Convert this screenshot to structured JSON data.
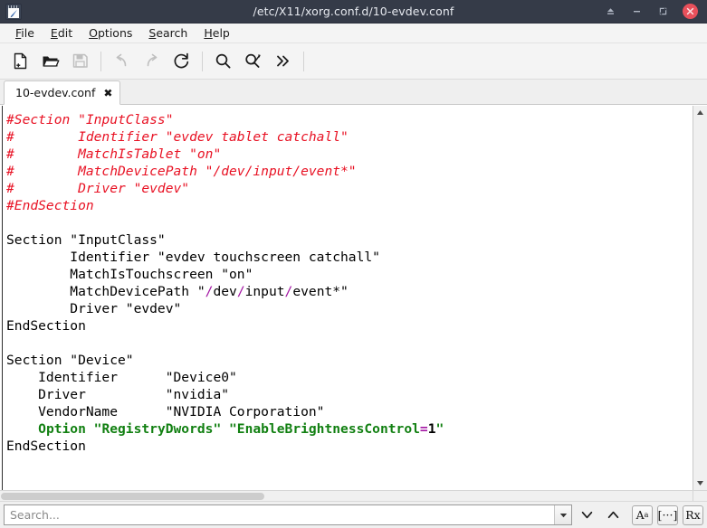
{
  "window": {
    "title": "/etc/X11/xorg.conf.d/10-evdev.conf",
    "icon": "text-editor-icon",
    "titlebar_color": "#353b48",
    "buttons": [
      {
        "name": "shade-button",
        "glyph": "eject"
      },
      {
        "name": "minimize-button",
        "glyph": "minus"
      },
      {
        "name": "restore-button",
        "glyph": "restore"
      },
      {
        "name": "close-button",
        "glyph": "cross",
        "color": "#e8505b"
      }
    ]
  },
  "menubar": {
    "items": [
      {
        "mnemonic": "F",
        "rest": "ile",
        "name": "menu-file"
      },
      {
        "mnemonic": "E",
        "rest": "dit",
        "name": "menu-edit"
      },
      {
        "mnemonic": "O",
        "rest": "ptions",
        "name": "menu-options"
      },
      {
        "mnemonic": "S",
        "rest": "earch",
        "name": "menu-search"
      },
      {
        "mnemonic": "H",
        "rest": "elp",
        "name": "menu-help"
      }
    ]
  },
  "toolbar": {
    "buttons": [
      {
        "name": "new-file-icon",
        "label": "New",
        "enabled": true
      },
      {
        "name": "open-folder-icon",
        "label": "Open",
        "enabled": true
      },
      {
        "name": "save-icon",
        "label": "Save",
        "enabled": false
      },
      {
        "name": "undo-icon",
        "label": "Undo",
        "enabled": false
      },
      {
        "name": "redo-icon",
        "label": "Redo",
        "enabled": false
      },
      {
        "name": "reload-icon",
        "label": "Reload",
        "enabled": true
      },
      {
        "name": "search-icon",
        "label": "Find",
        "enabled": true
      },
      {
        "name": "find-replace-icon",
        "label": "Find/Replace",
        "enabled": true
      },
      {
        "name": "overflow-chevrons-icon",
        "label": "More",
        "enabled": true
      }
    ]
  },
  "tabs": [
    {
      "label": "10-evdev.conf",
      "close": "✖",
      "active": true
    }
  ],
  "editor": {
    "lines": [
      [
        {
          "t": "#Section \"InputClass\"",
          "c": "cmt"
        }
      ],
      [
        {
          "t": "#        Identifier \"evdev tablet catchall\"",
          "c": "cmt"
        }
      ],
      [
        {
          "t": "#        MatchIsTablet \"on\"",
          "c": "cmt"
        }
      ],
      [
        {
          "t": "#        MatchDevicePath \"/dev/input/event*\"",
          "c": "cmt"
        }
      ],
      [
        {
          "t": "#        Driver \"evdev\"",
          "c": "cmt"
        }
      ],
      [
        {
          "t": "#EndSection",
          "c": "cmt"
        }
      ],
      [
        {
          "t": "",
          "c": ""
        }
      ],
      [
        {
          "t": "Section \"InputClass\"",
          "c": ""
        }
      ],
      [
        {
          "t": "        Identifier \"evdev touchscreen catchall\"",
          "c": ""
        }
      ],
      [
        {
          "t": "        MatchIsTouchscreen \"on\"",
          "c": ""
        }
      ],
      [
        {
          "t": "        MatchDevicePath \"",
          "c": ""
        },
        {
          "t": "/",
          "c": "slash"
        },
        {
          "t": "dev",
          "c": ""
        },
        {
          "t": "/",
          "c": "slash"
        },
        {
          "t": "input",
          "c": ""
        },
        {
          "t": "/",
          "c": "slash"
        },
        {
          "t": "event*\"",
          "c": ""
        }
      ],
      [
        {
          "t": "        Driver \"evdev\"",
          "c": ""
        }
      ],
      [
        {
          "t": "EndSection",
          "c": ""
        }
      ],
      [
        {
          "t": "",
          "c": ""
        }
      ],
      [
        {
          "t": "Section \"Device\"",
          "c": ""
        }
      ],
      [
        {
          "t": "    Identifier      \"Device0\"",
          "c": ""
        }
      ],
      [
        {
          "t": "    Driver          \"nvidia\"",
          "c": ""
        }
      ],
      [
        {
          "t": "    VendorName      \"NVIDIA Corporation\"",
          "c": ""
        }
      ],
      [
        {
          "t": "    ",
          "c": ""
        },
        {
          "t": "Option \"RegistryDwords\" \"EnableBrightnessControl",
          "c": "opt"
        },
        {
          "t": "=",
          "c": "pnc"
        },
        {
          "t": "1",
          "c": "num"
        },
        {
          "t": "\"",
          "c": "opt"
        }
      ],
      [
        {
          "t": "EndSection",
          "c": ""
        }
      ]
    ]
  },
  "search": {
    "placeholder": "Search...",
    "value": "",
    "dropdown_glyph": "▼",
    "find_next_glyph": "∨",
    "find_prev_glyph": "∧",
    "options": [
      {
        "name": "match-case-button",
        "label": "A",
        "sup": "a"
      },
      {
        "name": "whole-word-button",
        "label": "[···]",
        "sup": ""
      },
      {
        "name": "regex-button",
        "label": "Rx",
        "sup": ""
      }
    ]
  },
  "scrollbars": {
    "v_up_glyph": "▲",
    "v_down_glyph": "▼"
  }
}
